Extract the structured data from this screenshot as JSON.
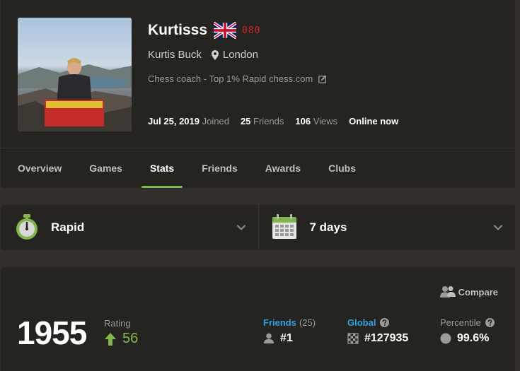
{
  "profile": {
    "username": "Kurtisss",
    "flag_country": "United Kingdom",
    "badge": "080",
    "real_name": "Kurtis Buck",
    "location": "London",
    "bio": "Chess coach - Top 1% Rapid chess.com",
    "joined_date": "Jul 25, 2019",
    "joined_label": "Joined",
    "friends_count": "25",
    "friends_label": "Friends",
    "views_count": "106",
    "views_label": "Views",
    "status": "Online now"
  },
  "tabs": [
    {
      "label": "Overview"
    },
    {
      "label": "Games"
    },
    {
      "label": "Stats",
      "active": true
    },
    {
      "label": "Friends"
    },
    {
      "label": "Awards"
    },
    {
      "label": "Clubs"
    }
  ],
  "selectors": {
    "game_type": {
      "label": "Rapid",
      "icon": "stopwatch-icon",
      "color": "#81b64c"
    },
    "period": {
      "label": "7 days",
      "icon": "calendar-icon"
    }
  },
  "rating": {
    "compare_label": "Compare",
    "value": "1955",
    "label": "Rating",
    "change": "56",
    "change_color": "#81b64c",
    "friends": {
      "label": "Friends",
      "count": "(25)",
      "rank": "#1"
    },
    "global": {
      "label": "Global",
      "rank": "#127935"
    },
    "percentile": {
      "label": "Percentile",
      "value": "99.6%"
    }
  },
  "colors": {
    "background": "#312e2b",
    "card": "#262421",
    "accent_green": "#81b64c",
    "link_blue": "#2ea0e2"
  }
}
